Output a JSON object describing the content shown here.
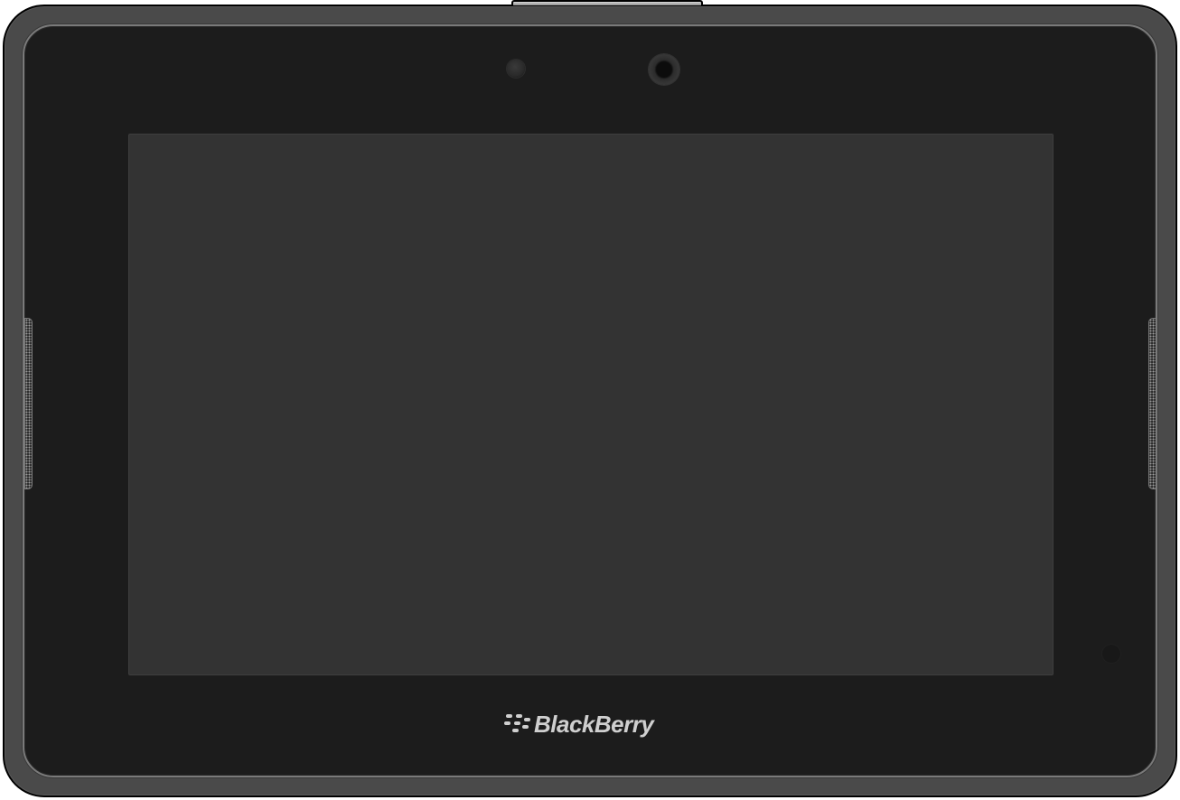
{
  "device": {
    "brand_text": "BlackBerry",
    "logo_icon": "blackberry-logo-icon"
  },
  "colors": {
    "frame": "#4a4a4a",
    "bezel": "#1c1c1c",
    "screen": "#333333",
    "logo_text": "#cfcfcf"
  }
}
